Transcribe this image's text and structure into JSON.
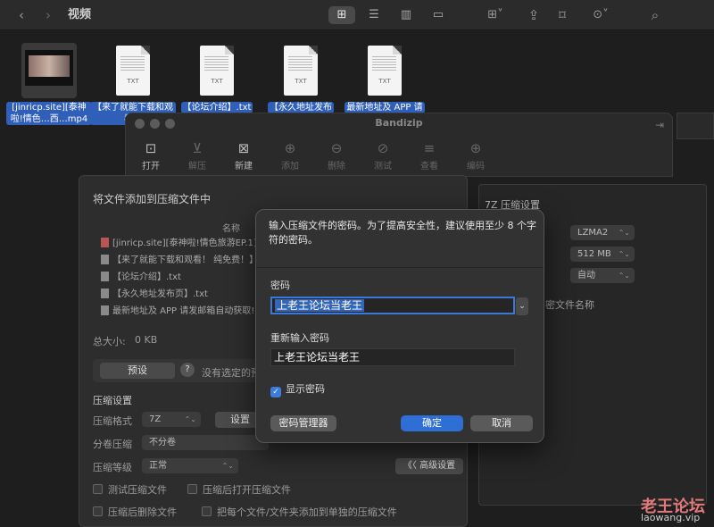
{
  "finder": {
    "title": "视频",
    "files": [
      {
        "name": "[jinricp.site][泰神啦!情色…西…mp4",
        "kind": "video"
      },
      {
        "name": "【来了就能下载和观看！",
        "kind": "txt"
      },
      {
        "name": "【论坛介绍】.txt",
        "kind": "txt"
      },
      {
        "name": "【永久地址发布",
        "kind": "txt"
      },
      {
        "name": "最新地址及 APP 请",
        "kind": "txt"
      }
    ],
    "txt_ext": "TXT"
  },
  "bandizip": {
    "title": "Bandizip",
    "toolbar": [
      "打开",
      "解压",
      "新建",
      "添加",
      "删除",
      "测试",
      "查看",
      "编码"
    ]
  },
  "add_dialog": {
    "heading": "将文件添加到压缩文件中",
    "name_col": "名称",
    "files": [
      "[jinricp.site][泰神啦!情色旅游EP.1]西",
      "【来了就能下载和观看！ 纯免费！】.txt",
      "【论坛介绍】.txt",
      "【永久地址发布页】.txt",
      "最新地址及 APP 请发邮箱自动获取!!"
    ],
    "total_label": "总大小:",
    "total_value": "0 KB",
    "preset_btn": "预设",
    "preset_help": "?",
    "preset_text": "没有选定的预",
    "section": "压缩设置",
    "format_label": "压缩格式",
    "format_value": "7Z",
    "settings_btn": "设置",
    "split_label": "分卷压缩",
    "split_value": "不分卷",
    "level_label": "压缩等级",
    "level_value": "正常",
    "advanced_btn": "《〈 高级设置",
    "opt_test": "测试压缩文件",
    "opt_open": "压缩后打开压缩文件",
    "opt_delete": "压缩后删除文件",
    "opt_each": "把每个文件/文件夹添加到单独的压缩文件"
  },
  "right_panel": {
    "title": "7Z 压缩设置",
    "method": "LZMA2",
    "dict": "512 MB",
    "word": "自动",
    "encrypt_names": "密文件名称"
  },
  "password_dialog": {
    "message": "输入压缩文件的密码。为了提高安全性，建议使用至少 8 个字符的密码。",
    "password_label": "密码",
    "password_value": "上老王论坛当老王",
    "confirm_label": "重新输入密码",
    "confirm_value": "上老王论坛当老王",
    "show_password": "显示密码",
    "show_password_checked": true,
    "manager_btn": "密码管理器",
    "ok_btn": "确定",
    "cancel_btn": "取消"
  },
  "watermark": {
    "title": "老王论坛",
    "url": "laowang.vip"
  }
}
